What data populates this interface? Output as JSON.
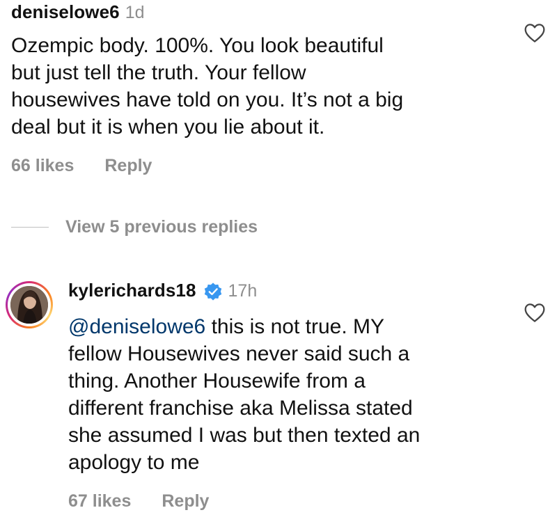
{
  "comments": [
    {
      "username": "deniselowe6",
      "timestamp": "1d",
      "lines": [
        "Ozempic body. 100%. You look beautiful",
        "but just tell the truth. Your fellow",
        "housewives have told on you. It’s not a big",
        "deal but it is when you lie about it."
      ],
      "likes": "66 likes",
      "reply_label": "Reply"
    },
    {
      "username": "kylerichards18",
      "verified": true,
      "timestamp": "17h",
      "mention": "@deniselowe6",
      "lines": [
        " this is not true. MY",
        "fellow Housewives never said such a",
        "thing. Another Housewife from a",
        "different franchise aka Melissa stated",
        "she assumed I was but then texted an",
        "apology to me"
      ],
      "likes": "67 likes",
      "reply_label": "Reply"
    }
  ],
  "view_replies": {
    "label": "View 5 previous replies"
  },
  "icons": {
    "like": "heart-outline-icon",
    "verified": "verified-badge-icon",
    "avatar": "profile-photo"
  },
  "colors": {
    "text": "#111111",
    "muted": "#8e8e8e",
    "mention": "#00376b",
    "verified": "#3897f0"
  }
}
